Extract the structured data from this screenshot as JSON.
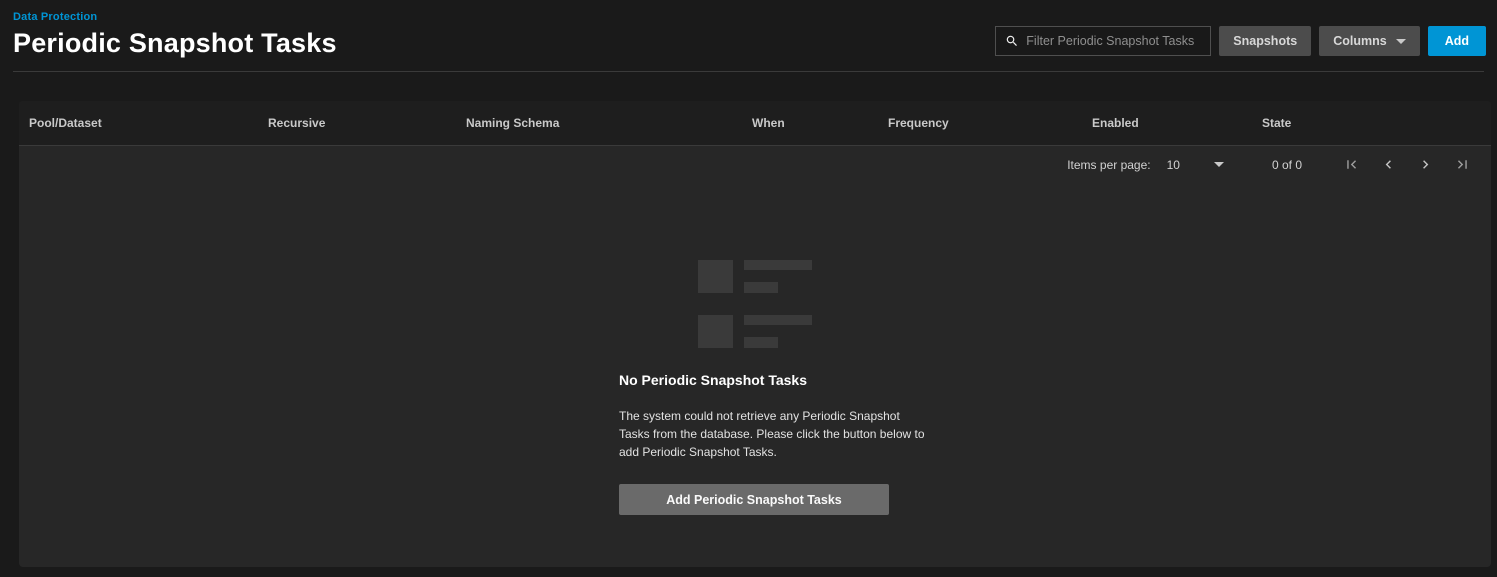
{
  "page": {
    "breadcrumb": "Data Protection",
    "title": "Periodic Snapshot Tasks"
  },
  "toolbar": {
    "filter_placeholder": "Filter Periodic Snapshot Tasks",
    "snapshots_label": "Snapshots",
    "columns_label": "Columns",
    "add_label": "Add"
  },
  "table": {
    "columns": [
      "Pool/Dataset",
      "Recursive",
      "Naming Schema",
      "When",
      "Frequency",
      "Enabled",
      "State"
    ]
  },
  "pagination": {
    "items_per_page_label": "Items per page:",
    "items_per_page_value": "10",
    "range_label": "0 of 0"
  },
  "empty_state": {
    "title": "No Periodic Snapshot Tasks",
    "message": "The system could not retrieve any Periodic Snapshot Tasks from the database. Please click the button below to add Periodic Snapshot Tasks.",
    "button_label": "Add Periodic Snapshot Tasks"
  },
  "icons": {
    "search": "magnifier-glyph",
    "columns_caret": "triangle-down",
    "items_per_page_caret": "triangle-down",
    "first_page": "bar-chevron-left",
    "previous_page": "chevron-left",
    "next_page": "chevron-right",
    "last_page": "chevron-bar-right"
  },
  "colors": {
    "accent_blue": "#0095d5",
    "page_background": "#1a1a1a",
    "card_background": "#272727",
    "table_header_background": "#1e1e1e",
    "gray_button": "#4c4c4c",
    "empty_button_gray": "#6a6a6a",
    "skeleton_block": "#3a3a3a"
  }
}
